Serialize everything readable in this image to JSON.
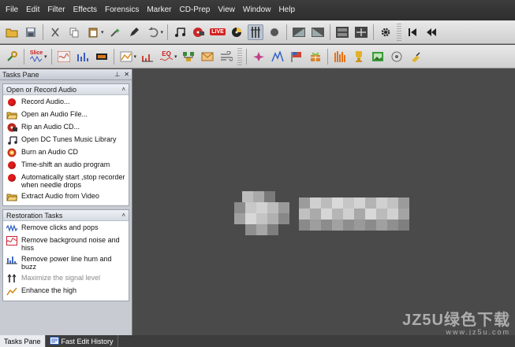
{
  "menu": [
    "File",
    "Edit",
    "Filter",
    "Effects",
    "Forensics",
    "Marker",
    "CD-Prep",
    "View",
    "Window",
    "Help"
  ],
  "toolbar": {
    "live_label": "LIVE",
    "eq_label": "EQ",
    "slice_label": "Slice"
  },
  "tasks_pane": {
    "title": "Tasks Pane",
    "pin_glyph": "⊥",
    "close_glyph": "✕",
    "collapse_glyph": "˄",
    "sections": [
      {
        "title": "Open or Record Audio",
        "items": [
          {
            "label": "Record Audio...",
            "icon": "record-icon",
            "disabled": false
          },
          {
            "label": "Open an Audio File...",
            "icon": "folder-open-icon",
            "disabled": false
          },
          {
            "label": "Rip an Audio CD...",
            "icon": "rip-cd-icon",
            "disabled": false
          },
          {
            "label": "Open DC Tunes Music Library",
            "icon": "music-library-icon",
            "disabled": false
          },
          {
            "label": "Burn an Audio CD",
            "icon": "burn-cd-icon",
            "disabled": false
          },
          {
            "label": "Time-shift an audio program",
            "icon": "record-icon",
            "disabled": false
          },
          {
            "label": "Automatically start ,stop recorder when needle drops",
            "icon": "record-icon",
            "disabled": false
          },
          {
            "label": "Extract Audio from Video",
            "icon": "folder-video-icon",
            "disabled": false
          }
        ]
      },
      {
        "title": "Restoration Tasks",
        "items": [
          {
            "label": "Remove clicks and pops",
            "icon": "declick-icon",
            "disabled": false
          },
          {
            "label": "Remove background noise and hiss",
            "icon": "denoise-icon",
            "disabled": false
          },
          {
            "label": "Remove power line hum and buzz",
            "icon": "dehum-icon",
            "disabled": false
          },
          {
            "label": "Maximize the signal level",
            "icon": "maximize-icon",
            "disabled": true
          },
          {
            "label": "Enhance the high",
            "icon": "enhance-icon",
            "disabled": false
          }
        ]
      }
    ]
  },
  "bottom_tabs": [
    {
      "label": "Tasks Pane",
      "active": true
    },
    {
      "label": "Fast Edit History",
      "active": false
    }
  ],
  "watermark": {
    "main": "JZ5U绿色下载",
    "sub": "www.jz5u.com"
  },
  "colors": {
    "workspace": "#4a4a4a",
    "menubar": "#333333",
    "record_red": "#e11a1a"
  }
}
